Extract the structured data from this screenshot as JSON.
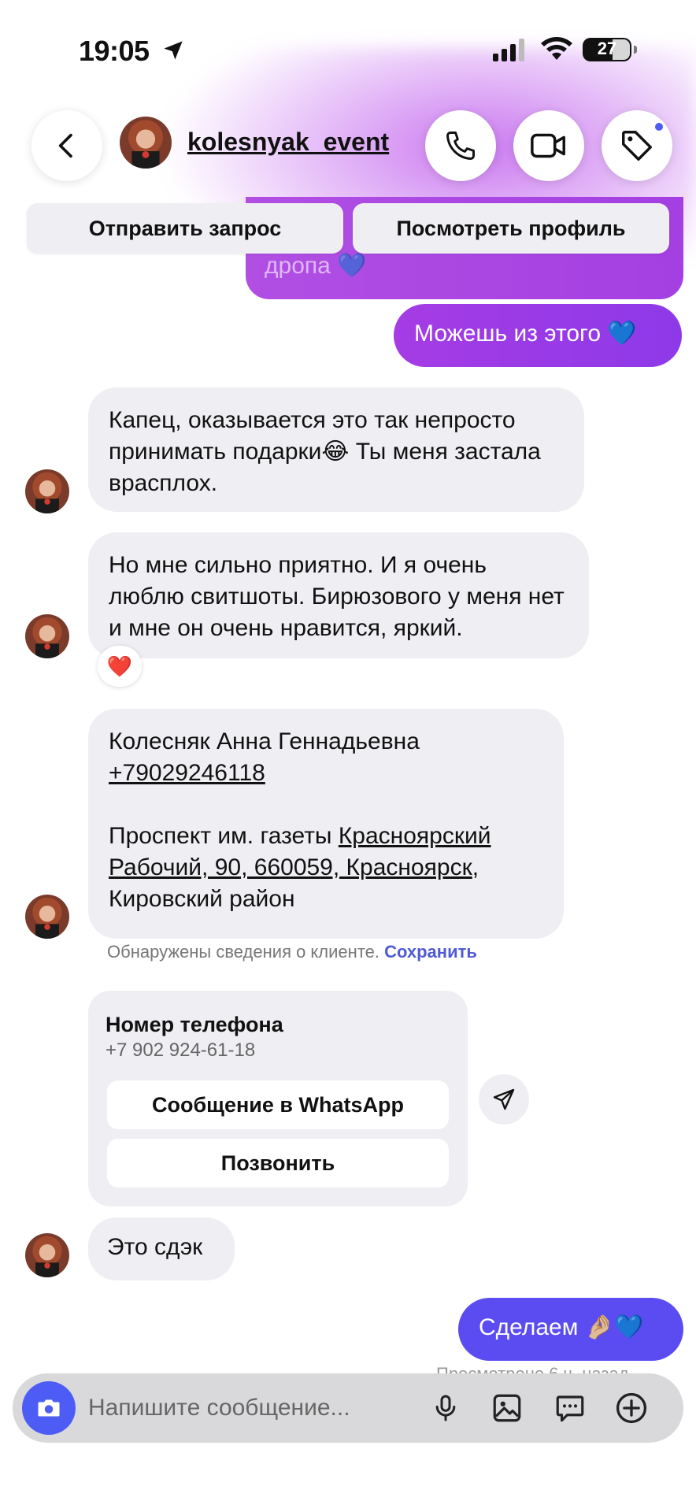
{
  "status_bar": {
    "time": "19:05",
    "battery": "27"
  },
  "header": {
    "username": "kolesnyak_event"
  },
  "actions": {
    "send_request": "Отправить запрос",
    "view_profile": "Посмотреть профиль"
  },
  "messages": {
    "sent_partial": "дропа 💙",
    "sent_1": "Можешь из этого 💙",
    "recv_1": "Капец, оказывается это так непросто принимать подарки😂 Ты меня застала врасплох.",
    "recv_2": "Но мне сильно приятно. И я очень люблю свитшоты. Бирюзового у меня нет и мне он очень нравится, яркий.",
    "reaction": "❤️",
    "recv_3": {
      "name": "Колесняк Анна Геннадьевна",
      "phone": "+79029246118",
      "addr_prefix": "Проспект им. газеты ",
      "addr_link": "Красноярский Рабочий, 90, 660059, Красноярск",
      "addr_suffix": ", Кировский район"
    },
    "client_info": {
      "text": "Обнаружены сведения о клиенте. ",
      "save": "Сохранить"
    },
    "contact_card": {
      "title": "Номер телефона",
      "phone": "+7 902 924-61-18",
      "whatsapp": "Сообщение в WhatsApp",
      "call": "Позвонить"
    },
    "recv_4": "Это сдэк",
    "sent_2": "Сделаем 🤌🏼💙",
    "seen": "Просмотрено 6 ч. назад"
  },
  "composer": {
    "placeholder": "Напишите сообщение..."
  },
  "colors": {
    "accent": "#4d5cf5",
    "sent_purple": "#a53ce5",
    "sent_blue": "#5a4cf0",
    "bubble_in": "#efeff3"
  }
}
